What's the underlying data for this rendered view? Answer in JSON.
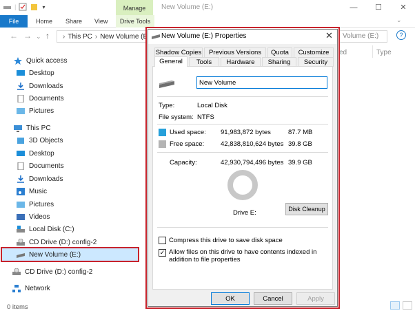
{
  "window": {
    "title": "New Volume (E:)",
    "manage_tab": "Manage"
  },
  "ribbon": {
    "file": "File",
    "tabs": [
      "Home",
      "Share",
      "View"
    ],
    "drive_tools": "Drive Tools"
  },
  "address": {
    "this_pc": "This PC",
    "crumb": "New Volume (E:)",
    "search_placeholder": "Volume (E:)"
  },
  "nav": {
    "quick_access": "Quick access",
    "qa_items": [
      "Desktop",
      "Downloads",
      "Documents",
      "Pictures"
    ],
    "this_pc": "This PC",
    "pc_items": [
      "3D Objects",
      "Desktop",
      "Documents",
      "Downloads",
      "Music",
      "Pictures",
      "Videos",
      "Local Disk (C:)",
      "CD Drive (D:) config-2",
      "New Volume (E:)"
    ],
    "cd_drive": "CD Drive (D:) config-2",
    "network": "Network"
  },
  "columns": {
    "ed": "ed",
    "type": "Type"
  },
  "status": {
    "items": "0 items"
  },
  "dialog": {
    "title": "New Volume (E:) Properties",
    "tabs_row1": [
      "Shadow Copies",
      "Previous Versions",
      "Quota",
      "Customize"
    ],
    "tabs_row2": [
      "General",
      "Tools",
      "Hardware",
      "Sharing",
      "Security"
    ],
    "volume_name": "New Volume",
    "type_label": "Type:",
    "type_value": "Local Disk",
    "fs_label": "File system:",
    "fs_value": "NTFS",
    "used_label": "Used space:",
    "used_bytes": "91,983,872 bytes",
    "used_size": "87.7 MB",
    "free_label": "Free space:",
    "free_bytes": "42,838,810,624 bytes",
    "free_size": "39.8 GB",
    "cap_label": "Capacity:",
    "cap_bytes": "42,930,794,496 bytes",
    "cap_size": "39.9 GB",
    "used_fraction": 0.002,
    "drive_label": "Drive E:",
    "disk_cleanup": "Disk Cleanup",
    "compress_label": "Compress this drive to save disk space",
    "index_label": "Allow files on this drive to have contents indexed in addition to file properties",
    "ok": "OK",
    "cancel": "Cancel",
    "apply": "Apply"
  },
  "colors": {
    "used": "#26a0da",
    "free": "#b4b4b4",
    "accent": "#1979ca",
    "highlight": "#c8232c"
  }
}
